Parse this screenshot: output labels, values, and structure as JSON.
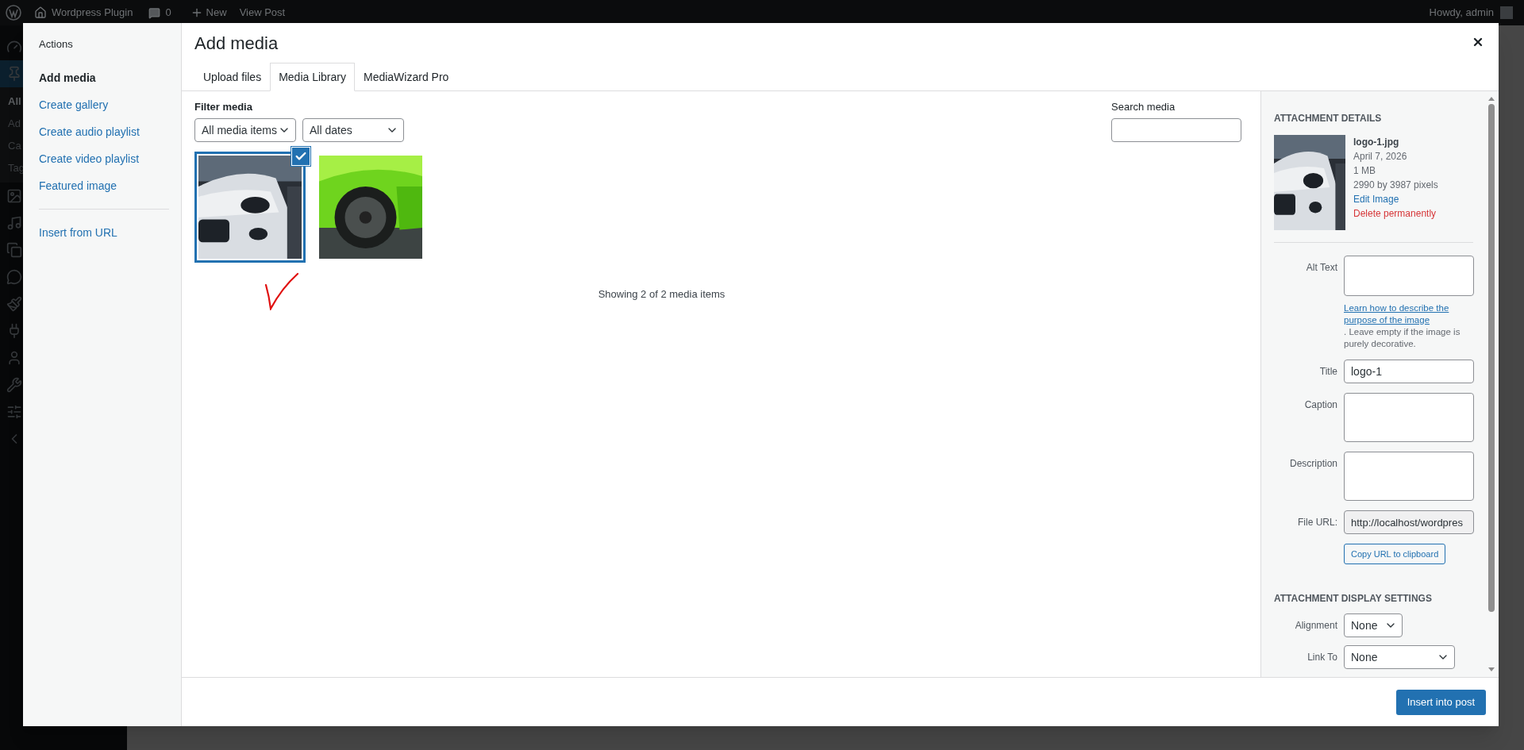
{
  "admin_bar": {
    "site": "Wordpress Plugin",
    "comments": "0",
    "new": "New",
    "view_post": "View Post",
    "greeting": "Howdy, admin"
  },
  "background_menu": [
    {
      "label": "All",
      "selected": true
    },
    {
      "label": "Ad",
      "selected": false
    },
    {
      "label": "Ca",
      "selected": false
    },
    {
      "label": "Tag",
      "selected": false
    }
  ],
  "modal": {
    "actions_heading": "Actions",
    "actions": [
      {
        "label": "Add media",
        "selected": true
      },
      {
        "label": "Create gallery",
        "selected": false
      },
      {
        "label": "Create audio playlist",
        "selected": false
      },
      {
        "label": "Create video playlist",
        "selected": false
      },
      {
        "label": "Featured image",
        "selected": false
      }
    ],
    "extra_actions": [
      {
        "label": "Insert from URL",
        "selected": false
      }
    ],
    "title": "Add media",
    "tabs": [
      {
        "label": "Upload files",
        "selected": false
      },
      {
        "label": "Media Library",
        "selected": true
      },
      {
        "label": "MediaWizard Pro",
        "selected": false
      }
    ],
    "filter_label": "Filter media",
    "filters": [
      {
        "value": "All media items"
      },
      {
        "value": "All dates"
      }
    ],
    "search_label": "Search media",
    "items": [
      {
        "kind": "picture",
        "selected": true
      },
      {
        "kind": "picture",
        "selected": false
      }
    ],
    "count": "Showing 2 of 2 media items",
    "details": {
      "heading": "ATTACHMENT DETAILS",
      "filename": "logo-1.jpg",
      "date": "April 7, 2026",
      "size": "1 MB",
      "dimensions": "2990 by 3987 pixels",
      "edit": "Edit Image",
      "delete": "Delete permanently",
      "fields": [
        {
          "label": "Alt Text",
          "kind": "textarea",
          "help_link": "Learn how to describe the purpose of the image",
          "help_text": ". Leave empty if the image is purely decorative."
        },
        {
          "label": "Title",
          "kind": "text",
          "value": "logo-1"
        },
        {
          "label": "Caption",
          "kind": "textarea"
        },
        {
          "label": "Description",
          "kind": "textarea"
        },
        {
          "label": "File URL:",
          "kind": "readonly",
          "value": "http://localhost/wordpres",
          "button": "Copy URL to clipboard"
        }
      ],
      "display_heading": "ATTACHMENT DISPLAY SETTINGS",
      "display_fields": [
        {
          "label": "Alignment",
          "value": "None",
          "kind": "short"
        },
        {
          "label": "Link To",
          "value": "None",
          "kind": "long"
        }
      ]
    },
    "insert_button": "Insert into post"
  }
}
